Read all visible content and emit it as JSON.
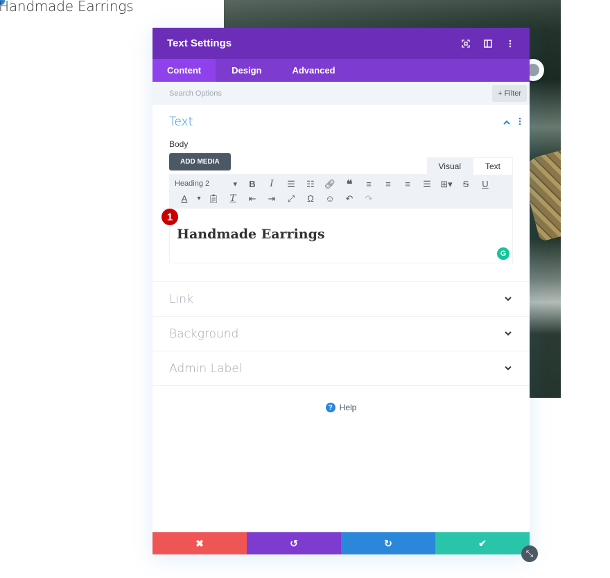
{
  "background_page": {
    "heading": "Handmade Earrings"
  },
  "modal": {
    "title": "Text Settings",
    "header_icons": [
      "focus-icon",
      "split-view-icon",
      "more-options-icon"
    ],
    "tabs": [
      {
        "label": "Content",
        "active": true
      },
      {
        "label": "Design",
        "active": false
      },
      {
        "label": "Advanced",
        "active": false
      }
    ],
    "search": {
      "placeholder": "Search Options",
      "value": ""
    },
    "filter_label": "+ Filter",
    "text_section": {
      "title": "Text",
      "body_label": "Body",
      "add_media_label": "ADD MEDIA",
      "editor_tabs": [
        "Visual",
        "Text"
      ],
      "format_select": "Heading 2",
      "editor_content": "Handmade Earrings",
      "annotation_badge": "1"
    },
    "collapsed_sections": [
      {
        "title": "Link"
      },
      {
        "title": "Background"
      },
      {
        "title": "Admin Label"
      }
    ],
    "help_label": "Help",
    "footer": {
      "cancel_color": "#ef5555",
      "undo_color": "#7e3bd0",
      "redo_color": "#2b87da",
      "save_color": "#29c4a9"
    }
  },
  "colors": {
    "header": "#6c2eb9",
    "tabs": "#7d3bcf",
    "active_tab": "#8f42ec",
    "accent_blue": "#2b87da"
  }
}
